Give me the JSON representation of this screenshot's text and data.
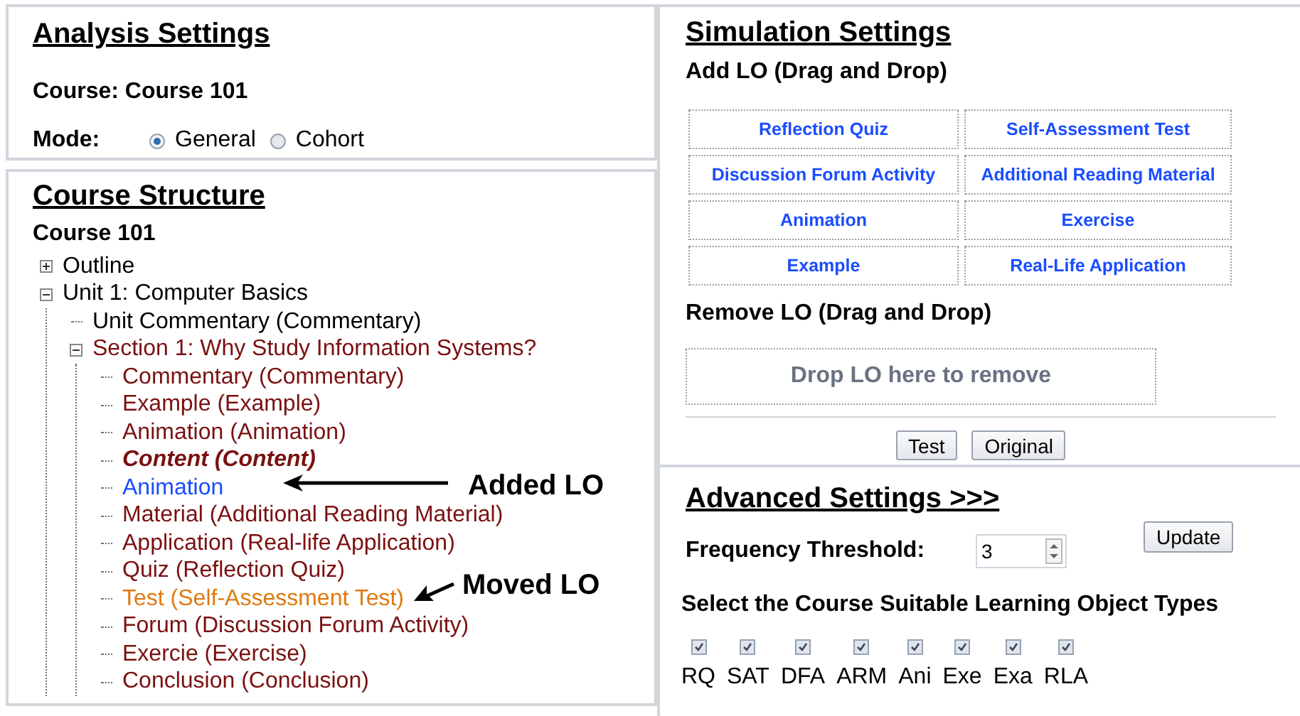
{
  "analysis_settings": {
    "title": "Analysis Settings",
    "course_label": "Course: Course 101",
    "mode_label": "Mode:",
    "modes": [
      {
        "label": "General",
        "selected": true
      },
      {
        "label": "Cohort",
        "selected": false
      }
    ]
  },
  "course_structure": {
    "title": "Course Structure",
    "course": "Course 101",
    "tree": [
      {
        "label": "Outline",
        "color": "#000000",
        "kind": "folder",
        "expanded": false
      },
      {
        "label": "Unit 1: Computer Basics",
        "color": "#000000",
        "kind": "folder",
        "expanded": true,
        "children": [
          {
            "label": "Unit Commentary (Commentary)",
            "color": "#000000",
            "kind": "leaf"
          },
          {
            "label": "Section 1: Why Study Information Systems?",
            "color": "#7a1010",
            "kind": "folder",
            "expanded": true,
            "children": [
              {
                "label": "Commentary (Commentary)",
                "color": "#7a1010",
                "kind": "leaf",
                "emphasis": false
              },
              {
                "label": "Example (Example)",
                "color": "#7a1010",
                "kind": "leaf",
                "emphasis": false
              },
              {
                "label": "Animation (Animation)",
                "color": "#7a1010",
                "kind": "leaf",
                "emphasis": false
              },
              {
                "label": "Content (Content)",
                "color": "#7a1010",
                "kind": "leaf",
                "emphasis": true
              },
              {
                "label": "Animation",
                "color": "#1a4dff",
                "kind": "leaf",
                "emphasis": false
              },
              {
                "label": "Material (Additional Reading Material)",
                "color": "#7a1010",
                "kind": "leaf",
                "emphasis": false
              },
              {
                "label": "Application (Real-life Application)",
                "color": "#7a1010",
                "kind": "leaf",
                "emphasis": false
              },
              {
                "label": "Quiz (Reflection Quiz)",
                "color": "#7a1010",
                "kind": "leaf",
                "emphasis": false
              },
              {
                "label": "Test (Self-Assessment Test)",
                "color": "#e07a10",
                "kind": "leaf",
                "emphasis": false
              },
              {
                "label": "Forum (Discussion Forum Activity)",
                "color": "#7a1010",
                "kind": "leaf",
                "emphasis": false
              },
              {
                "label": "Exercie (Exercise)",
                "color": "#7a1010",
                "kind": "leaf",
                "emphasis": false
              },
              {
                "label": "Conclusion (Conclusion)",
                "color": "#7a1010",
                "kind": "leaf",
                "emphasis": false
              }
            ]
          }
        ]
      }
    ],
    "annotations": [
      {
        "label": "Added LO"
      },
      {
        "label": "Moved LO"
      }
    ]
  },
  "simulation_settings": {
    "title": "Simulation Settings",
    "add_heading": "Add LO (Drag and Drop)",
    "learning_objects": [
      "Reflection Quiz",
      "Self-Assessment Test",
      "Discussion Forum Activity",
      "Additional Reading Material",
      "Animation",
      "Exercise",
      "Example",
      "Real-Life Application"
    ],
    "remove_heading": "Remove LO (Drag and Drop)",
    "drop_zone": "Drop LO here to remove",
    "buttons": [
      "Test",
      "Original"
    ]
  },
  "advanced_settings": {
    "title": "Advanced Settings >>>",
    "update_button": "Update",
    "threshold_label": "Frequency Threshold:",
    "threshold_value": "3",
    "types_heading": "Select the Course Suitable Learning Object Types",
    "types": [
      {
        "label": "RQ",
        "checked": true
      },
      {
        "label": "SAT",
        "checked": true
      },
      {
        "label": "DFA",
        "checked": true
      },
      {
        "label": "ARM",
        "checked": true
      },
      {
        "label": "Ani",
        "checked": true
      },
      {
        "label": "Exe",
        "checked": true
      },
      {
        "label": "Exa",
        "checked": true
      },
      {
        "label": "RLA",
        "checked": true
      }
    ]
  }
}
